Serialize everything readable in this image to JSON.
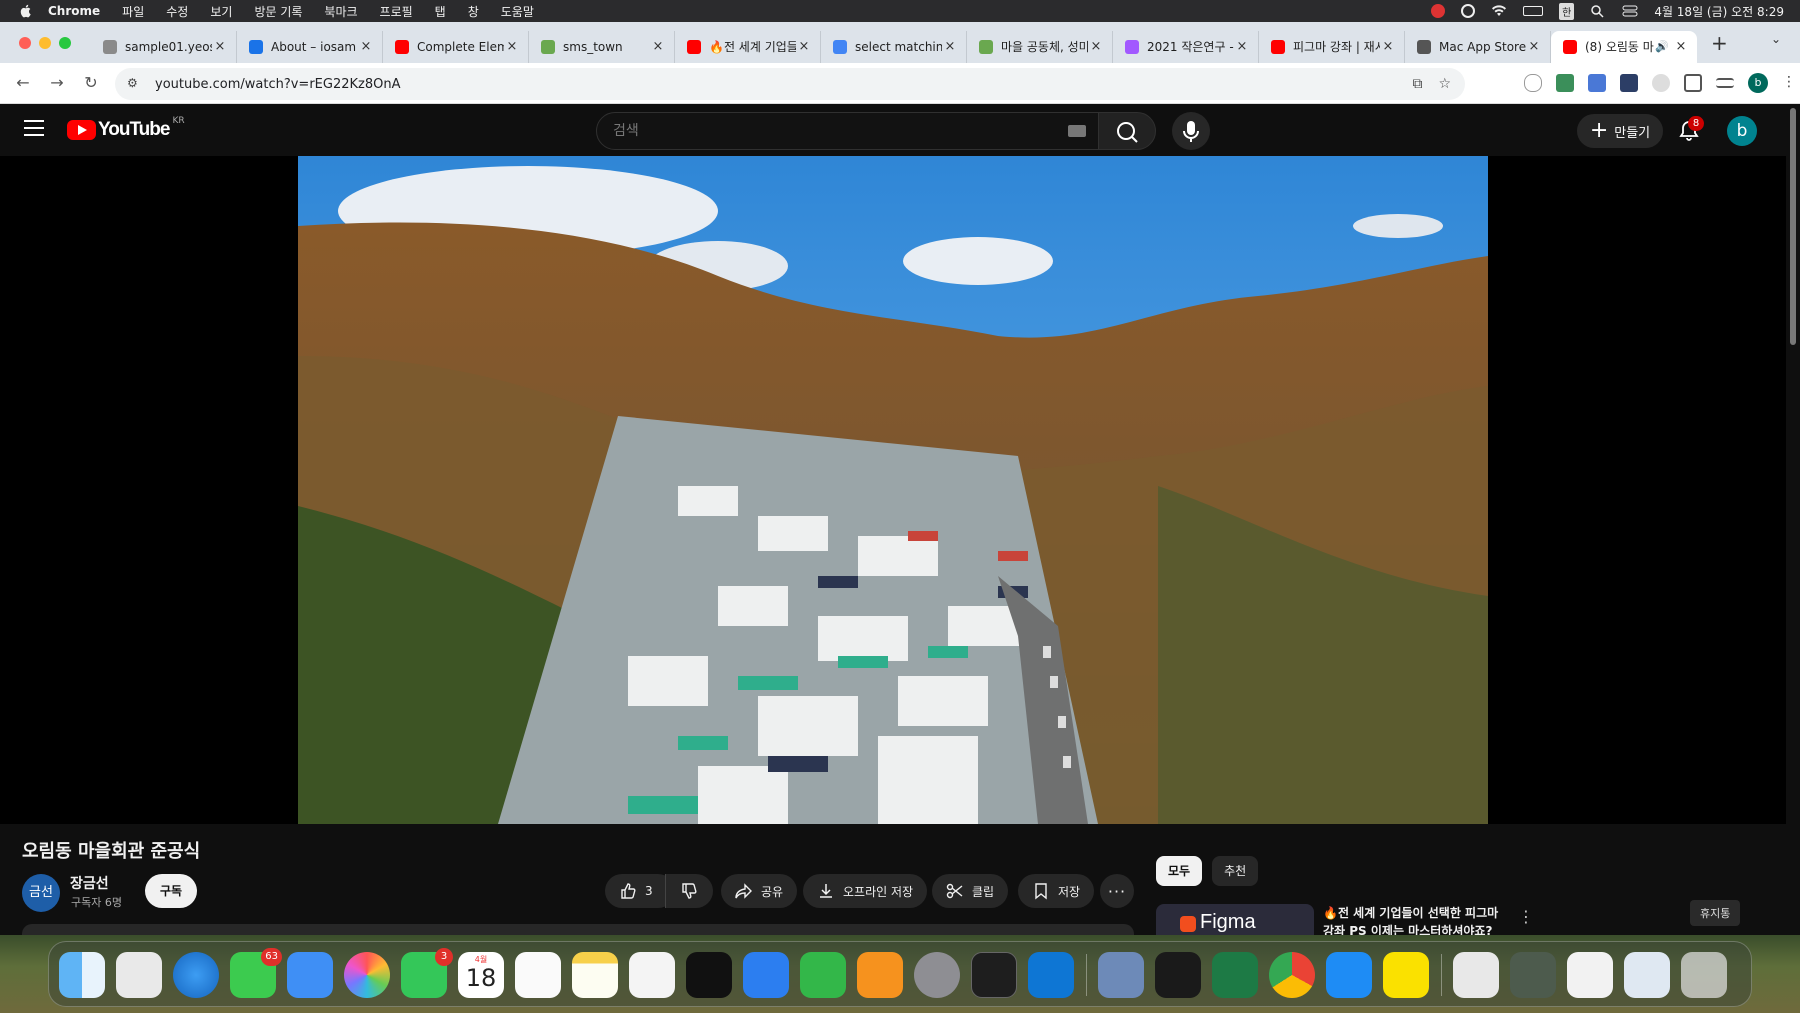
{
  "menubar": {
    "items": [
      "Chrome",
      "파일",
      "수정",
      "보기",
      "방문 기록",
      "북마크",
      "프로필",
      "탭",
      "창",
      "도움말"
    ],
    "input_method": "한",
    "datetime": "4월 18일 (금) 오전 8:29"
  },
  "tabs": [
    {
      "label": "sample01.yeos",
      "icon": "help-favicon-icon",
      "color": "#8a8a8a"
    },
    {
      "label": "About – iosam",
      "icon": "help-favicon-icon",
      "color": "#1a73e8"
    },
    {
      "label": "Complete Elem",
      "icon": "youtube-favicon-icon",
      "color": "#ff0000"
    },
    {
      "label": "sms_town",
      "icon": "map-favicon-icon",
      "color": "#6aa84f"
    },
    {
      "label": "🔥전 세계 기업들",
      "icon": "youtube-favicon-icon",
      "color": "#ff0000"
    },
    {
      "label": "select matchin",
      "icon": "google-favicon-icon",
      "color": "#4285f4"
    },
    {
      "label": "마을 공동체, 성미",
      "icon": "map-favicon-icon",
      "color": "#6aa84f"
    },
    {
      "label": "2021 작은연구 -",
      "icon": "figma-favicon-icon",
      "color": "#a259ff"
    },
    {
      "label": "피그마 강좌 | 재시",
      "icon": "youtube-favicon-icon",
      "color": "#ff0000"
    },
    {
      "label": "Mac App Store",
      "icon": "apple-favicon-icon",
      "color": "#555555"
    },
    {
      "label": "(8) 오림동 마",
      "icon": "youtube-favicon-icon",
      "color": "#ff0000",
      "active": true
    }
  ],
  "address": {
    "url": "youtube.com/watch?v=rEG22Kz8OnA"
  },
  "youtube": {
    "region": "KR",
    "search_placeholder": "검색",
    "create_label": "만들기",
    "notification_count": "8",
    "avatar_letter": "b"
  },
  "video": {
    "title": "오림동 마을회관 준공식",
    "channel_name": "장금선",
    "channel_avatar_text": "금선",
    "subscribers": "구독자 6명",
    "subscribe_label": "구독",
    "like_count": "3",
    "share_label": "공유",
    "offline_label": "오프라인 저장",
    "clip_label": "클립",
    "save_label": "저장"
  },
  "sidebar": {
    "chips": [
      "모두",
      "추천"
    ],
    "rec_thumb_text": "Figma",
    "rec_title": "🔥전 세계 기업들이 선택한 피그마 강좌 PS 이제는 마스터하셔야죠?"
  },
  "tooltip": "휴지통",
  "dock": {
    "badges": {
      "messages": "63",
      "facetime": "3"
    },
    "calendar_month": "4월",
    "calendar_day": "18"
  },
  "colors": {
    "youtube_red": "#ff0000",
    "dark_bg": "#0f0f0f",
    "chip_bg": "#272727"
  }
}
